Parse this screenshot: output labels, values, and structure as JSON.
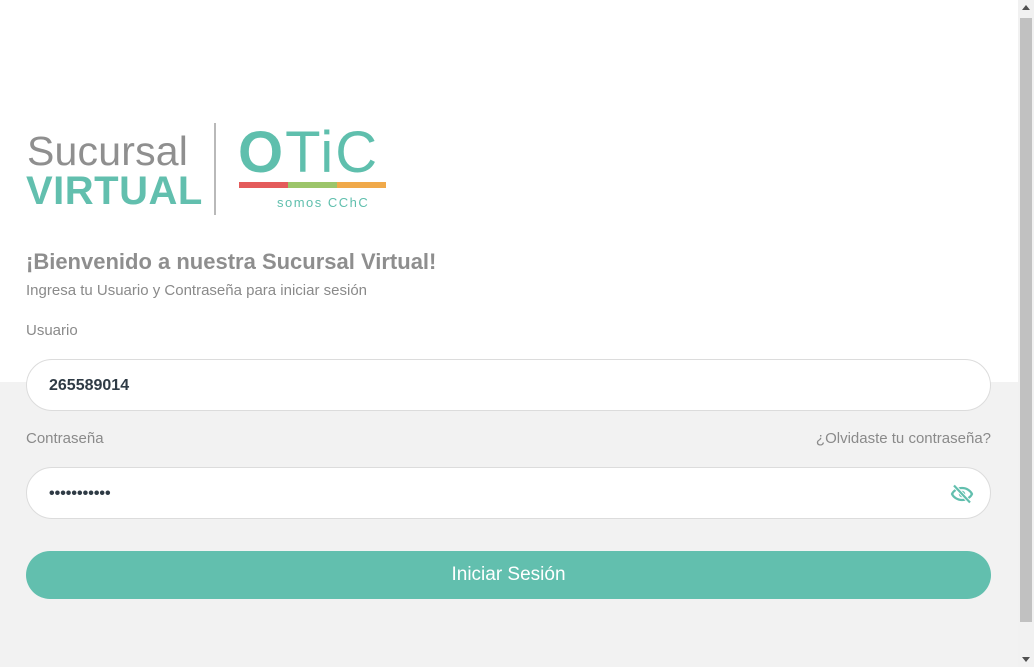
{
  "logo": {
    "line1": "Sucursal",
    "line2": "VIRTUAL",
    "mark_letter": "O",
    "mark_rest": "TiC",
    "tagline": "somos CChC",
    "stripe_colors": [
      "#e45b5b",
      "#9cc56a",
      "#f0a94a"
    ]
  },
  "welcome": {
    "title": "¡Bienvenido a nuestra Sucursal Virtual!",
    "subtitle": "Ingresa tu Usuario y Contraseña para iniciar sesión"
  },
  "form": {
    "user_label": "Usuario",
    "user_value": "265589014",
    "password_label": "Contraseña",
    "forgot_link": "¿Olvidaste tu contraseña?",
    "password_value": "•••••••••••",
    "submit_label": "Iniciar Sesión"
  },
  "colors": {
    "accent": "#62bfae",
    "muted_text": "#8a8a8a",
    "lower_bg": "#f2f2f2"
  }
}
